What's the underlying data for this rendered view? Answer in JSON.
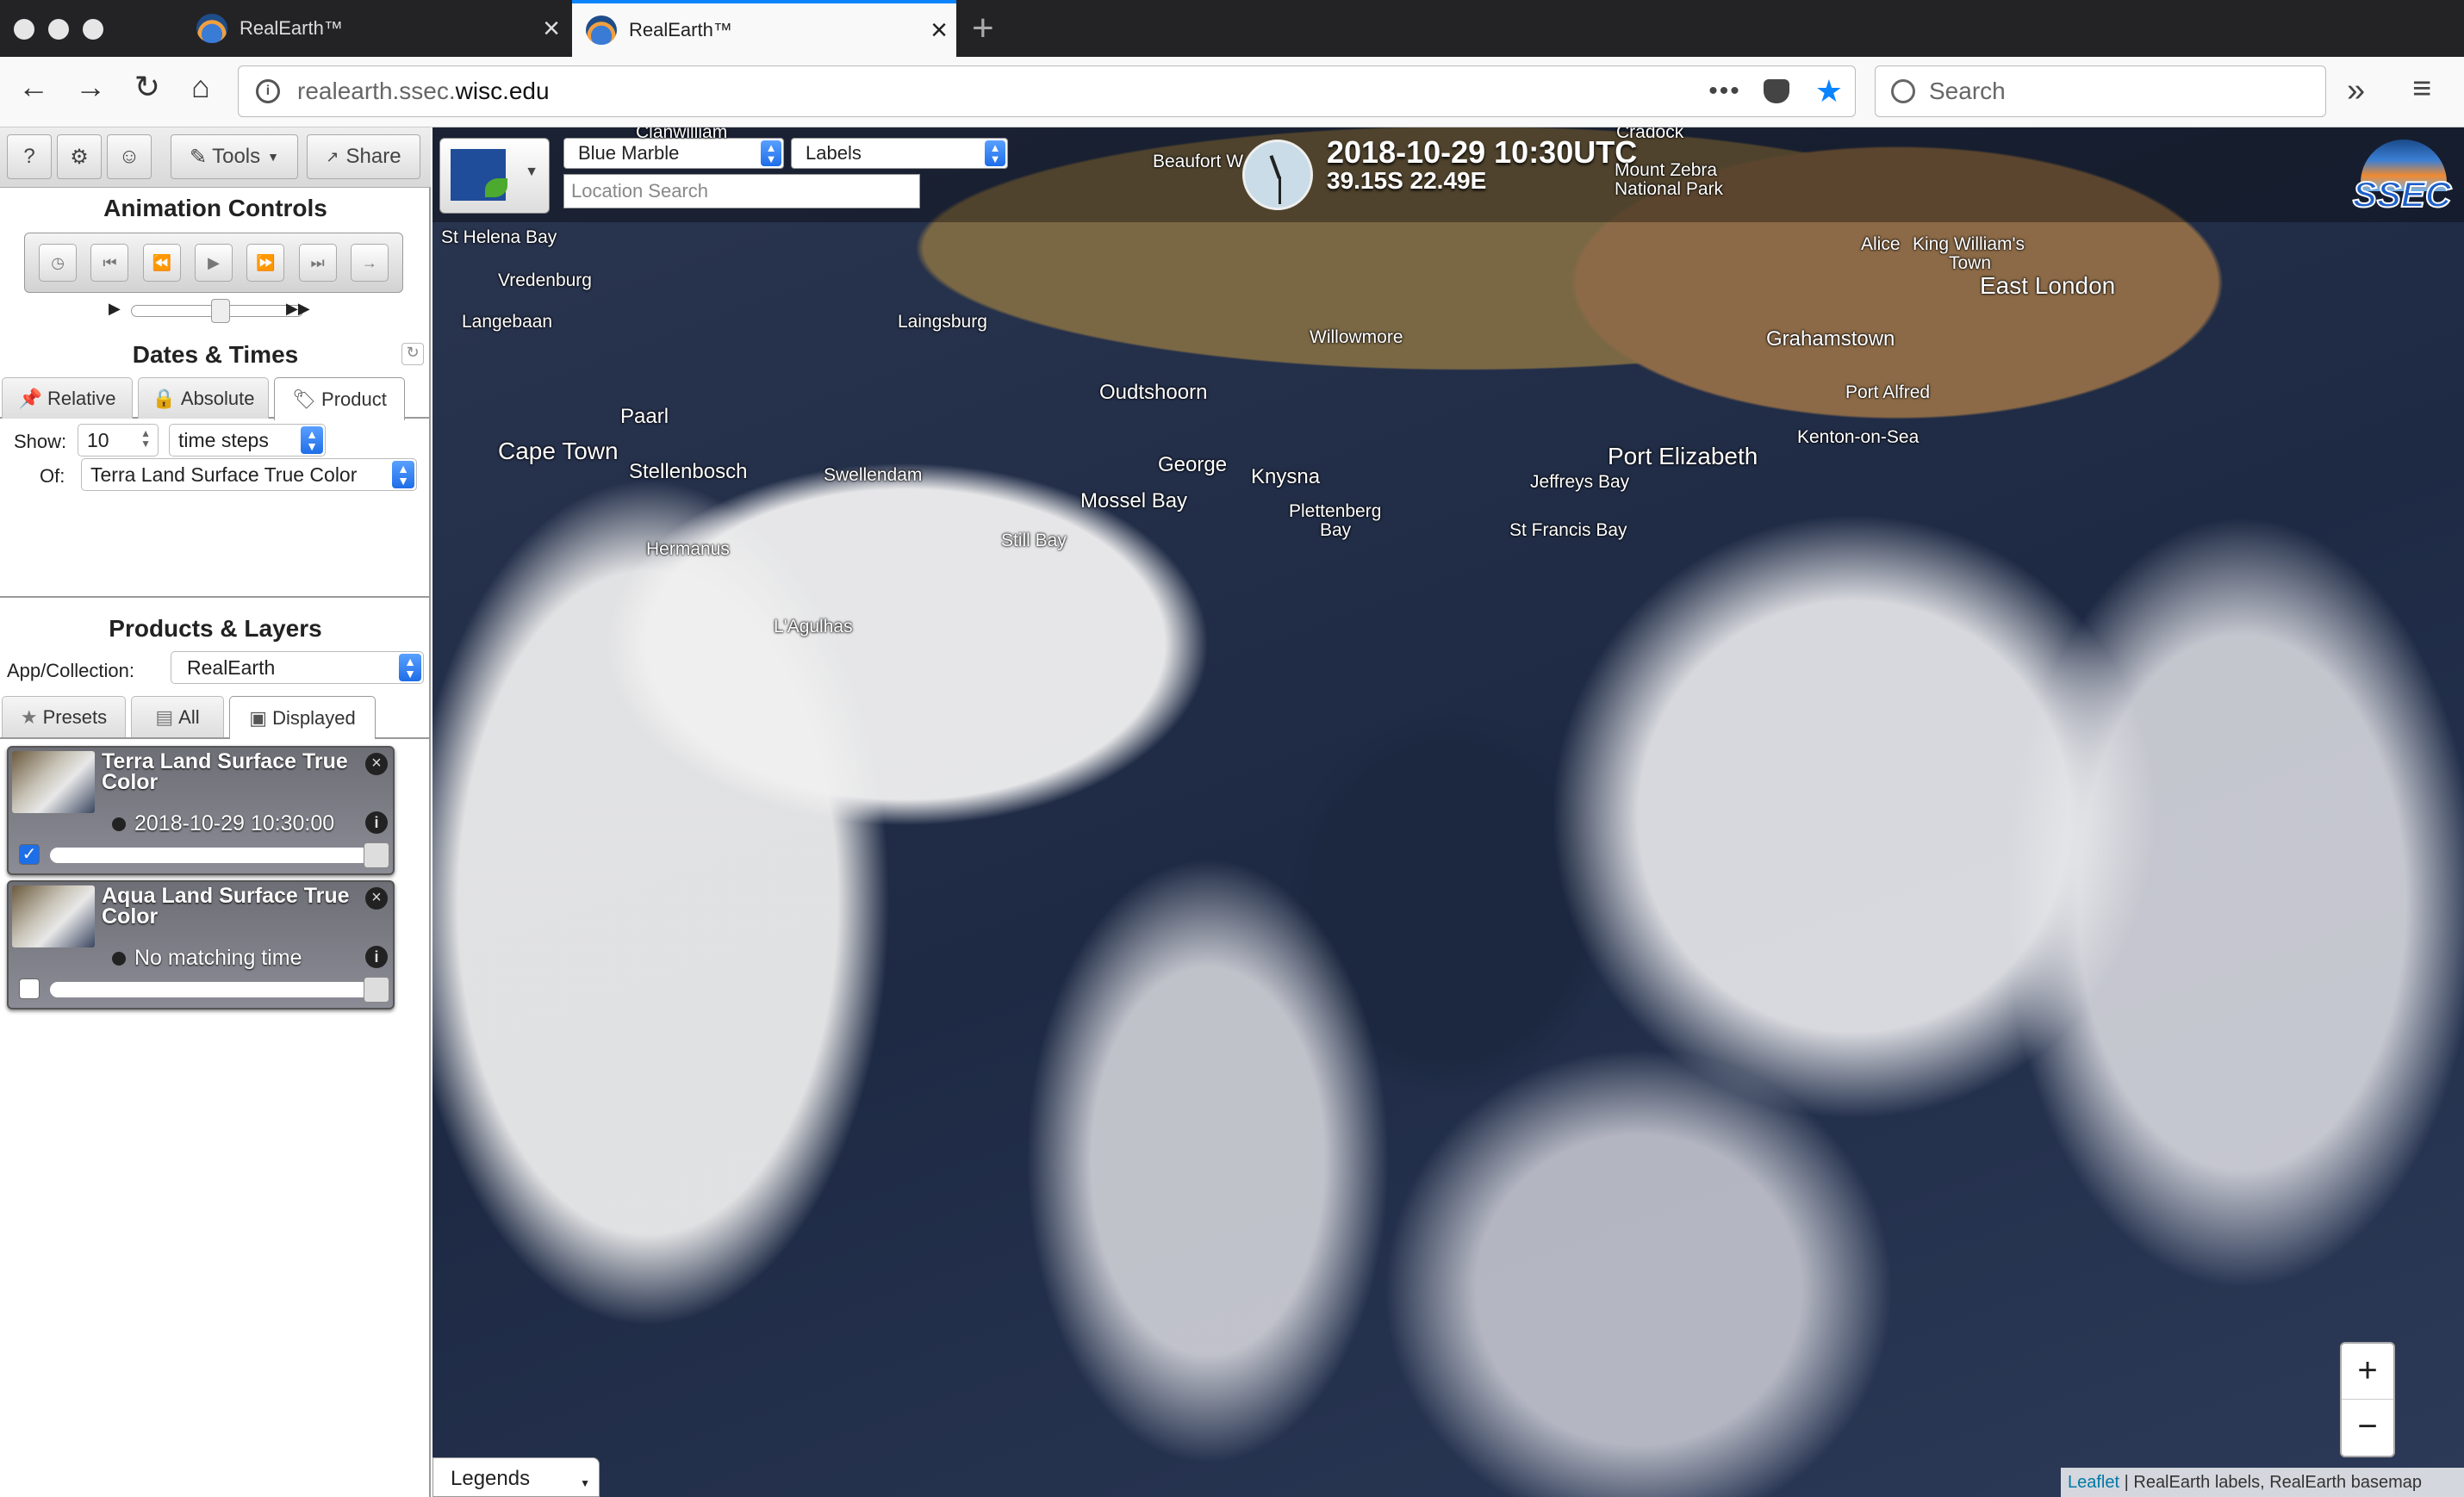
{
  "browser": {
    "tabs": [
      {
        "title": "RealEarth™"
      },
      {
        "title": "RealEarth™"
      }
    ],
    "url_host_prefix": "realearth.ssec.",
    "url_host_domain": "wisc.edu",
    "search_placeholder": "Search"
  },
  "toolbar": {
    "help_label": "?",
    "tools_label": "Tools",
    "share_label": "Share"
  },
  "animation": {
    "heading": "Animation Controls"
  },
  "dates": {
    "heading": "Dates & Times",
    "tabs": [
      "Relative",
      "Absolute",
      "Product"
    ],
    "active_tab": "Product",
    "show_label": "Show:",
    "show_value": "10",
    "units_value": "time steps",
    "of_label": "Of:",
    "of_value": "Terra Land Surface True Color"
  },
  "products": {
    "heading": "Products & Layers",
    "collection_label": "App/Collection:",
    "collection_value": "RealEarth",
    "tabs": [
      "Presets",
      "All",
      "Displayed"
    ],
    "active_tab": "Displayed",
    "layers": [
      {
        "name": "Terra Land Surface True Color",
        "time": "2018-10-29 10:30:00",
        "checked": true,
        "opacity": 1.0
      },
      {
        "name": "Aqua Land Surface True Color",
        "time": "No matching time",
        "checked": false,
        "opacity": 1.0
      }
    ]
  },
  "map": {
    "basemap": "Blue Marble",
    "overlay": "Labels",
    "location_placeholder": "Location Search",
    "datetime": "2018-10-29 10:30UTC",
    "coords": "39.15S 22.49E",
    "logo_text": "SSEC",
    "cities": {
      "clanwilliam": "Clanwilliam",
      "beaufort": "Beaufort W",
      "cradock": "Cradock",
      "mountzebra": "Mount Zebra",
      "nationalpark": "National Park",
      "sthelena": "St Helena Bay",
      "vredenburg": "Vredenburg",
      "langebaan": "Langebaan",
      "laingsburg": "Laingsburg",
      "willowmore": "Willowmore",
      "alice": "Alice",
      "kingwilliams": "King William's",
      "town": "Town",
      "eastlondon": "East London",
      "grahamstown": "Grahamstown",
      "oudtshoorn": "Oudtshoorn",
      "portalfred": "Port Alfred",
      "kenton": "Kenton-on-Sea",
      "paarl": "Paarl",
      "capetown": "Cape Town",
      "stellenbosch": "Stellenbosch",
      "swellendam": "Swellendam",
      "george": "George",
      "knysna": "Knysna",
      "mosselbay": "Mossel Bay",
      "plettenberg": "Plettenberg",
      "bay": "Bay",
      "portelizabeth": "Port Elizabeth",
      "jeffreys": "Jeffreys Bay",
      "stfrancis": "St Francis Bay",
      "hermanus": "Hermanus",
      "stillbay": "Still Bay",
      "agulhas": "L'Agulhas"
    },
    "zoom_in": "+",
    "zoom_out": "−",
    "legends_label": "Legends",
    "attribution_link": "Leaflet",
    "attribution_text": " | RealEarth labels, RealEarth basemap"
  }
}
